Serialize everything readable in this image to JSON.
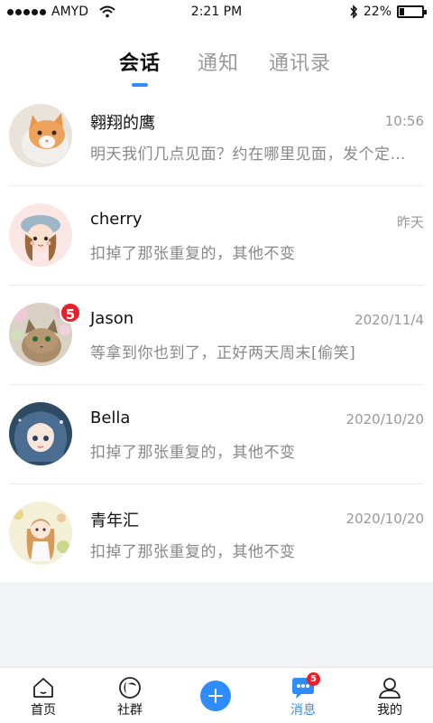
{
  "status_bar": {
    "carrier": "AMYD",
    "time": "2:21 PM",
    "battery": "22%",
    "battery_level": 0.22
  },
  "header": {
    "tabs": [
      {
        "label": "会话",
        "active": true
      },
      {
        "label": "通知",
        "active": false
      },
      {
        "label": "通讯录",
        "active": false
      }
    ]
  },
  "conversations": [
    {
      "name": "翱翔的鹰",
      "time": "10:56",
      "preview": "明天我们几点见面？约在哪里见面，发个定位过来",
      "avatar": "cat-orange"
    },
    {
      "name": "cherry",
      "time": "昨天",
      "preview": "扣掉了那张重复的，其他不变",
      "avatar": "girl-beret"
    },
    {
      "name": "Jason",
      "time": "2020/11/4",
      "preview": "等拿到你也到了，正好两天周末[偷笑]",
      "unread": "5",
      "avatar": "cat-flowers"
    },
    {
      "name": "Bella",
      "time": "2020/10/20",
      "preview": "扣掉了那张重复的，其他不变",
      "avatar": "girl-blue-hair"
    },
    {
      "name": "青年汇",
      "time": "2020/10/20",
      "preview": "扣掉了那张重复的，其他不变",
      "avatar": "girl-flowers"
    }
  ],
  "tab_bar": {
    "items": [
      {
        "label": "首页",
        "icon": "home-icon"
      },
      {
        "label": "社群",
        "icon": "community-icon"
      },
      {
        "label": "",
        "icon": "plus-icon"
      },
      {
        "label": "消息",
        "icon": "message-icon",
        "badge": "5",
        "active": true
      },
      {
        "label": "我的",
        "icon": "profile-icon"
      }
    ]
  },
  "colors": {
    "accent": "#2f8cff",
    "badge": "#e8202a",
    "muted": "#999999"
  }
}
